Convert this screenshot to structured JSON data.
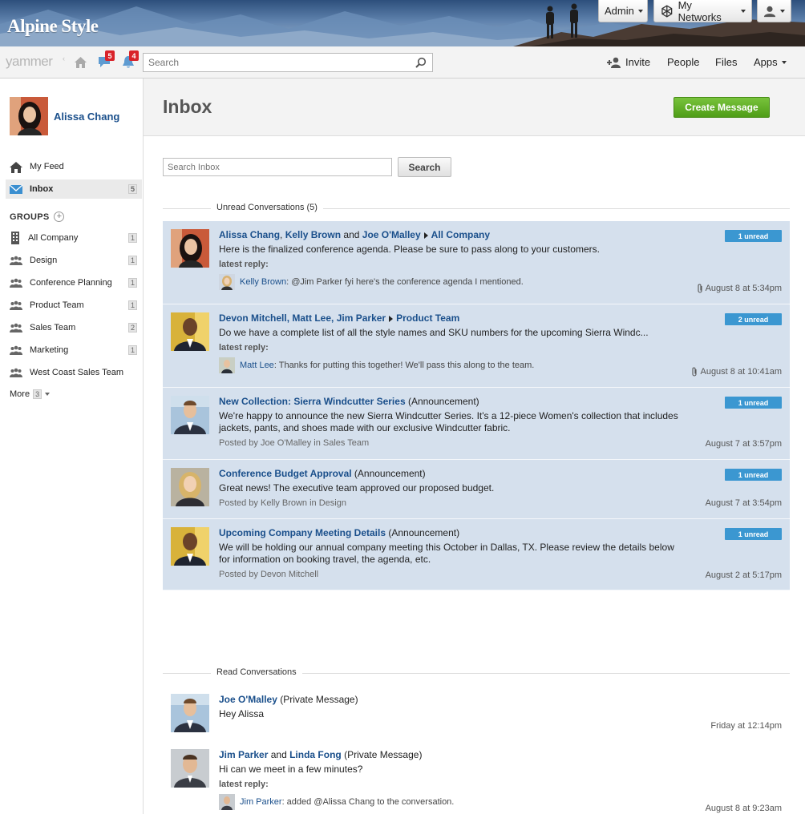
{
  "banner": {
    "brand": "Alpine Style",
    "admin_label": "Admin",
    "networks_label": "My Networks"
  },
  "topnav": {
    "logo": "yammer",
    "messages_count": "5",
    "notifications_count": "4",
    "search_placeholder": "Search",
    "invite": "Invite",
    "people": "People",
    "files": "Files",
    "apps": "Apps"
  },
  "sidebar": {
    "user_name": "Alissa Chang",
    "feed": "My Feed",
    "inbox": "Inbox",
    "inbox_count": "5",
    "groups_heading": "GROUPS",
    "groups": [
      {
        "label": "All Company",
        "count": "1"
      },
      {
        "label": "Design",
        "count": "1"
      },
      {
        "label": "Conference Planning",
        "count": "1"
      },
      {
        "label": "Product Team",
        "count": "1"
      },
      {
        "label": "Sales Team",
        "count": "2"
      },
      {
        "label": "Marketing",
        "count": "1"
      },
      {
        "label": "West Coast Sales Team",
        "count": ""
      }
    ],
    "more": "More",
    "more_count": "3"
  },
  "main": {
    "title": "Inbox",
    "create_label": "Create Message",
    "search_placeholder": "Search Inbox",
    "search_button": "Search",
    "unread_heading": "Unread Conversations  (5)",
    "read_heading": "Read Conversations",
    "unread": [
      {
        "p1": "Alissa Chang",
        "s1": ", ",
        "p2": "Kelly Brown",
        "s2": " and ",
        "p3": "Joe O'Malley",
        "group": "All Company",
        "text": "Here is the finalized conference agenda. Please be sure to pass along to your customers.",
        "latest": "latest reply:",
        "reply_name": "Kelly Brown",
        "reply_text": ": @Jim Parker fyi here's the conference agenda I mentioned.",
        "badge": "1 unread",
        "date": "August 8 at 5:34pm"
      },
      {
        "p1": "Devon Mitchell",
        "s1": ", ",
        "p2": "Matt Lee",
        "s2": ", ",
        "p3": "Jim Parker",
        "group": "Product Team",
        "text": "Do we have a complete list of all the style names and SKU numbers for the upcoming Sierra Windc...",
        "latest": "latest reply:",
        "reply_name": "Matt Lee",
        "reply_text": ": Thanks for putting this together! We'll pass this along to the team.",
        "badge": "2 unread",
        "date": "August 8 at 10:41am"
      },
      {
        "title": "New Collection: Sierra Windcutter Series",
        "kind": " (Announcement)",
        "text": "We're happy to announce the new Sierra Windcutter Series. It's a 12-piece Women's collection that includes jackets, pants, and shoes made with our exclusive Windcutter fabric.",
        "posted": "Posted by Joe O'Malley in Sales Team",
        "badge": "1 unread",
        "date": "August 7 at 3:57pm"
      },
      {
        "title": "Conference Budget Approval",
        "kind": " (Announcement)",
        "text": "Great news! The executive team approved our proposed budget.",
        "posted": "Posted by Kelly Brown in Design",
        "badge": "1 unread",
        "date": "August 7 at 3:54pm"
      },
      {
        "title": "Upcoming Company Meeting Details",
        "kind": " (Announcement)",
        "text": "We will be holding our annual company meeting this October in Dallas, TX. Please review the details below for information on booking travel, the agenda, etc.",
        "posted": "Posted by Devon Mitchell",
        "badge": "1 unread",
        "date": "August 2 at 5:17pm"
      }
    ],
    "read": [
      {
        "p1": "Joe O'Malley",
        "kind": " (Private Message)",
        "text": "Hey Alissa",
        "date": "Friday at 12:14pm"
      },
      {
        "p1": "Jim Parker",
        "s1": " and ",
        "p2": "Linda Fong",
        "kind": " (Private Message)",
        "text": "Hi can we meet in a few minutes?",
        "latest": "latest reply:",
        "reply_name": "Jim Parker",
        "reply_text": ": added @Alissa Chang to the conversation.",
        "date": "August 8 at 9:23am"
      }
    ]
  },
  "colors": {
    "link": "#1a4f8b",
    "unread_bg": "#d5e0ed",
    "badge_blue": "#3b97d1",
    "create_green": "#5aa81f",
    "alert_red": "#d9232a"
  }
}
